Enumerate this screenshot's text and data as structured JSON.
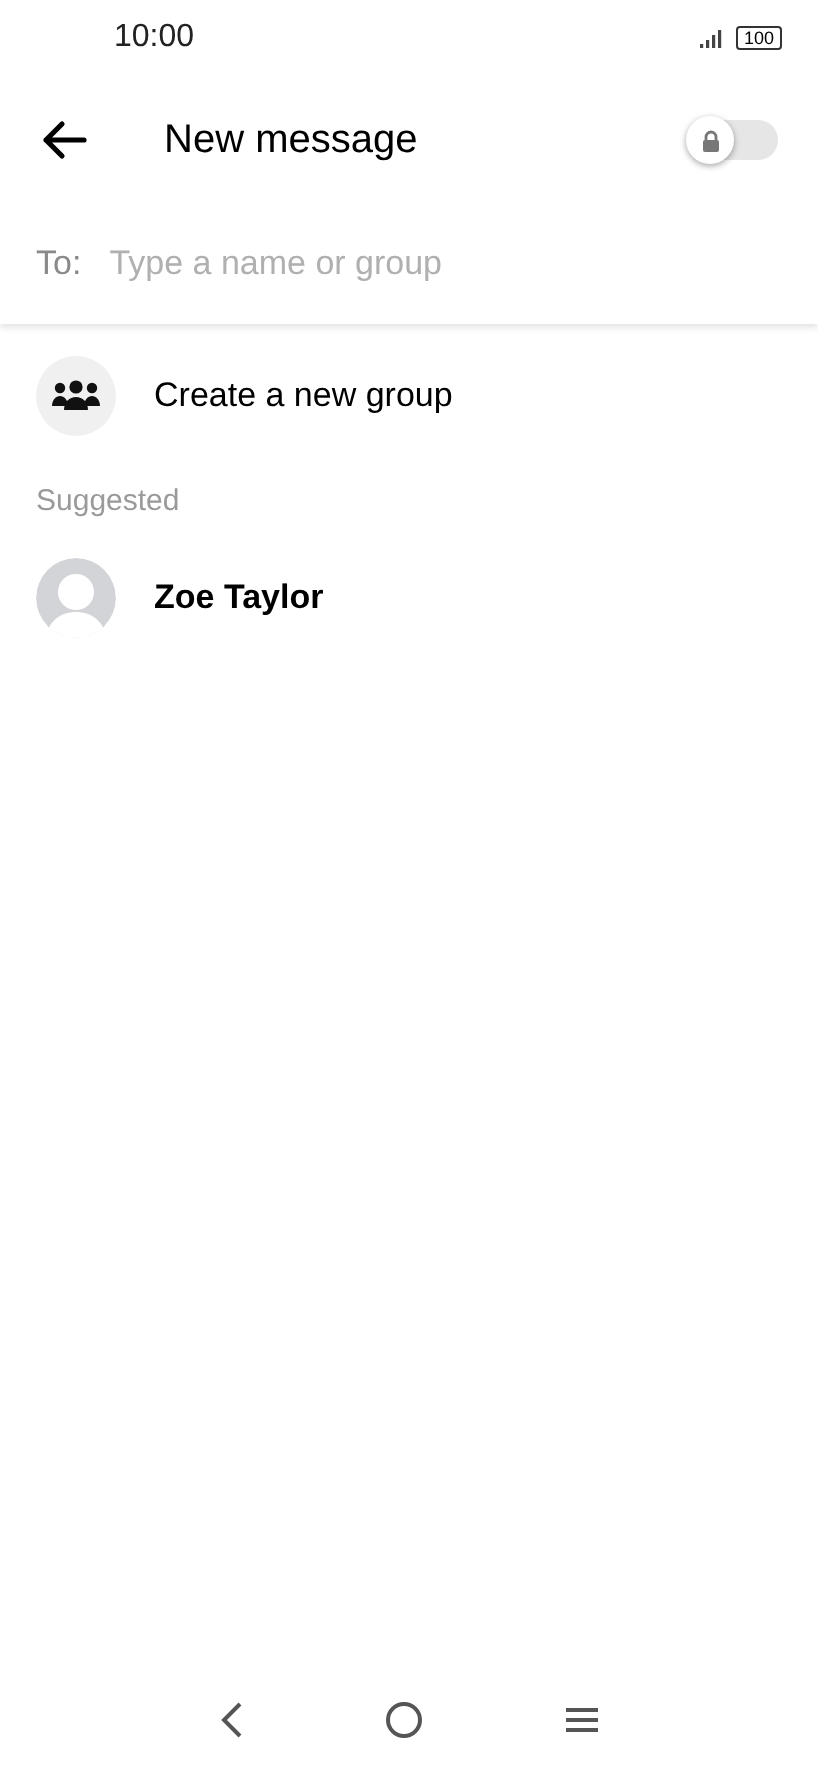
{
  "status_bar": {
    "time": "10:00",
    "battery": "100"
  },
  "header": {
    "title": "New message",
    "secret_toggle": {
      "on": false
    }
  },
  "to_field": {
    "label": "To:",
    "placeholder": "Type a name or group"
  },
  "create_group": {
    "label": "Create a new group"
  },
  "suggested": {
    "heading": "Suggested",
    "contacts": [
      {
        "name": "Zoe Taylor"
      }
    ]
  }
}
